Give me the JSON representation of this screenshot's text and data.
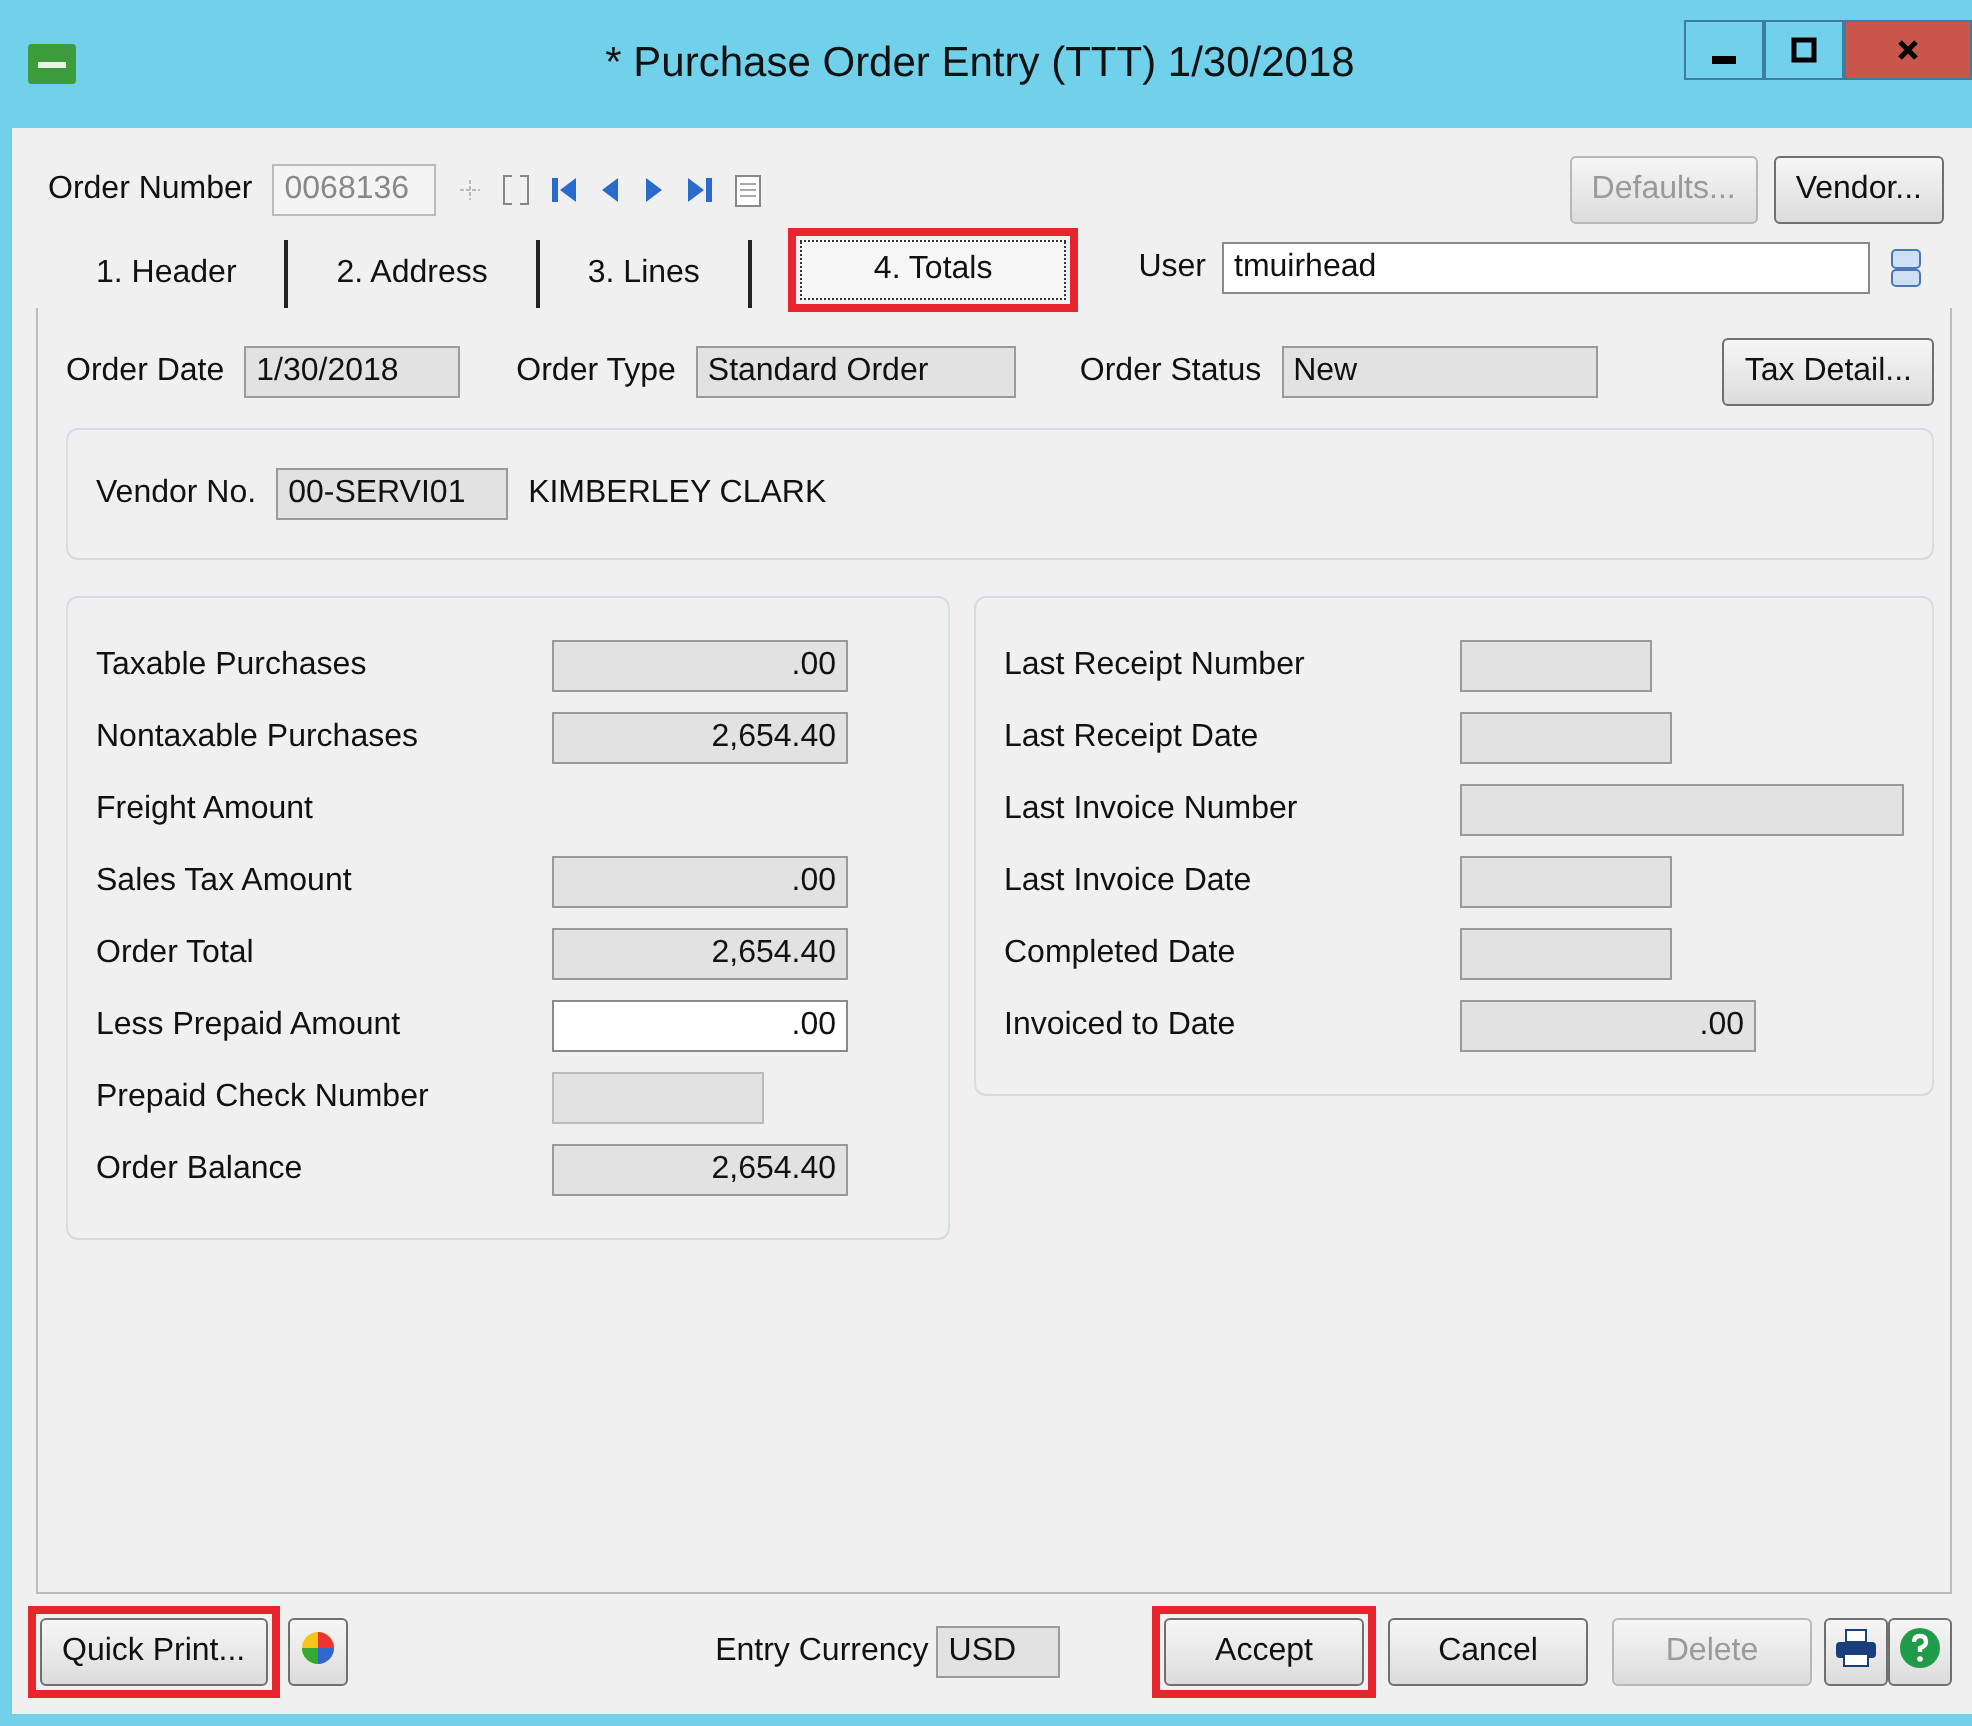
{
  "window": {
    "title": "* Purchase Order Entry (TTT) 1/30/2018"
  },
  "order_number": {
    "label": "Order Number",
    "value": "0068136",
    "disabled": true
  },
  "top_buttons": [
    {
      "label": "Defaults...",
      "disabled": true
    },
    {
      "label": "Vendor...",
      "disabled": false
    }
  ],
  "tabs": [
    {
      "label": "1. Header",
      "selected": false,
      "highlighted": false
    },
    {
      "label": "2. Address",
      "selected": false,
      "highlighted": false
    },
    {
      "label": "3. Lines",
      "selected": false,
      "highlighted": false
    },
    {
      "label": "4. Totals",
      "selected": true,
      "highlighted": true
    }
  ],
  "user": {
    "label": "User",
    "value": "tmuirhead"
  },
  "header_fields": [
    {
      "label": "Order Date",
      "value": "1/30/2018"
    },
    {
      "label": "Order Type",
      "value": "Standard Order"
    },
    {
      "label": "Order Status",
      "value": "New"
    }
  ],
  "tax_button": {
    "label": "Tax Detail..."
  },
  "vendor": {
    "label": "Vendor No.",
    "value": "00-SERVI01",
    "name": "KIMBERLEY CLARK"
  },
  "totals": [
    {
      "label": "Taxable Purchases",
      "kind": "field",
      "value": ".00",
      "editable": false
    },
    {
      "label": "Nontaxable Purchases",
      "kind": "field",
      "value": "2,654.40",
      "editable": false
    },
    {
      "label": "Freight Amount",
      "kind": "label"
    },
    {
      "label": "Sales Tax Amount",
      "kind": "field",
      "value": ".00",
      "editable": false
    },
    {
      "label": "Order Total",
      "kind": "field",
      "value": "2,654.40",
      "editable": false
    },
    {
      "label": "Less Prepaid Amount",
      "kind": "field",
      "value": ".00",
      "editable": true
    },
    {
      "label": "Prepaid Check Number",
      "kind": "short"
    },
    {
      "label": "Order Balance",
      "kind": "field",
      "value": "2,654.40",
      "editable": false
    }
  ],
  "history": [
    {
      "label": "Last Receipt Number",
      "kind": "short"
    },
    {
      "label": "Last Receipt Date",
      "kind": "date"
    },
    {
      "label": "Last Invoice Number",
      "kind": "long"
    },
    {
      "label": "Last Invoice Date",
      "kind": "date"
    },
    {
      "label": "Completed Date",
      "kind": "date"
    },
    {
      "label": "Invoiced to Date",
      "kind": "amount",
      "value": ".00"
    }
  ],
  "bottom": {
    "quick_print": {
      "label": "Quick Print...",
      "highlighted": true
    },
    "currency": {
      "label": "Entry Currency",
      "value": "USD"
    },
    "buttons": [
      {
        "label": "Accept",
        "disabled": false,
        "highlighted": true
      },
      {
        "label": "Cancel",
        "disabled": false,
        "highlighted": false
      },
      {
        "label": "Delete",
        "disabled": true,
        "highlighted": false
      }
    ]
  }
}
